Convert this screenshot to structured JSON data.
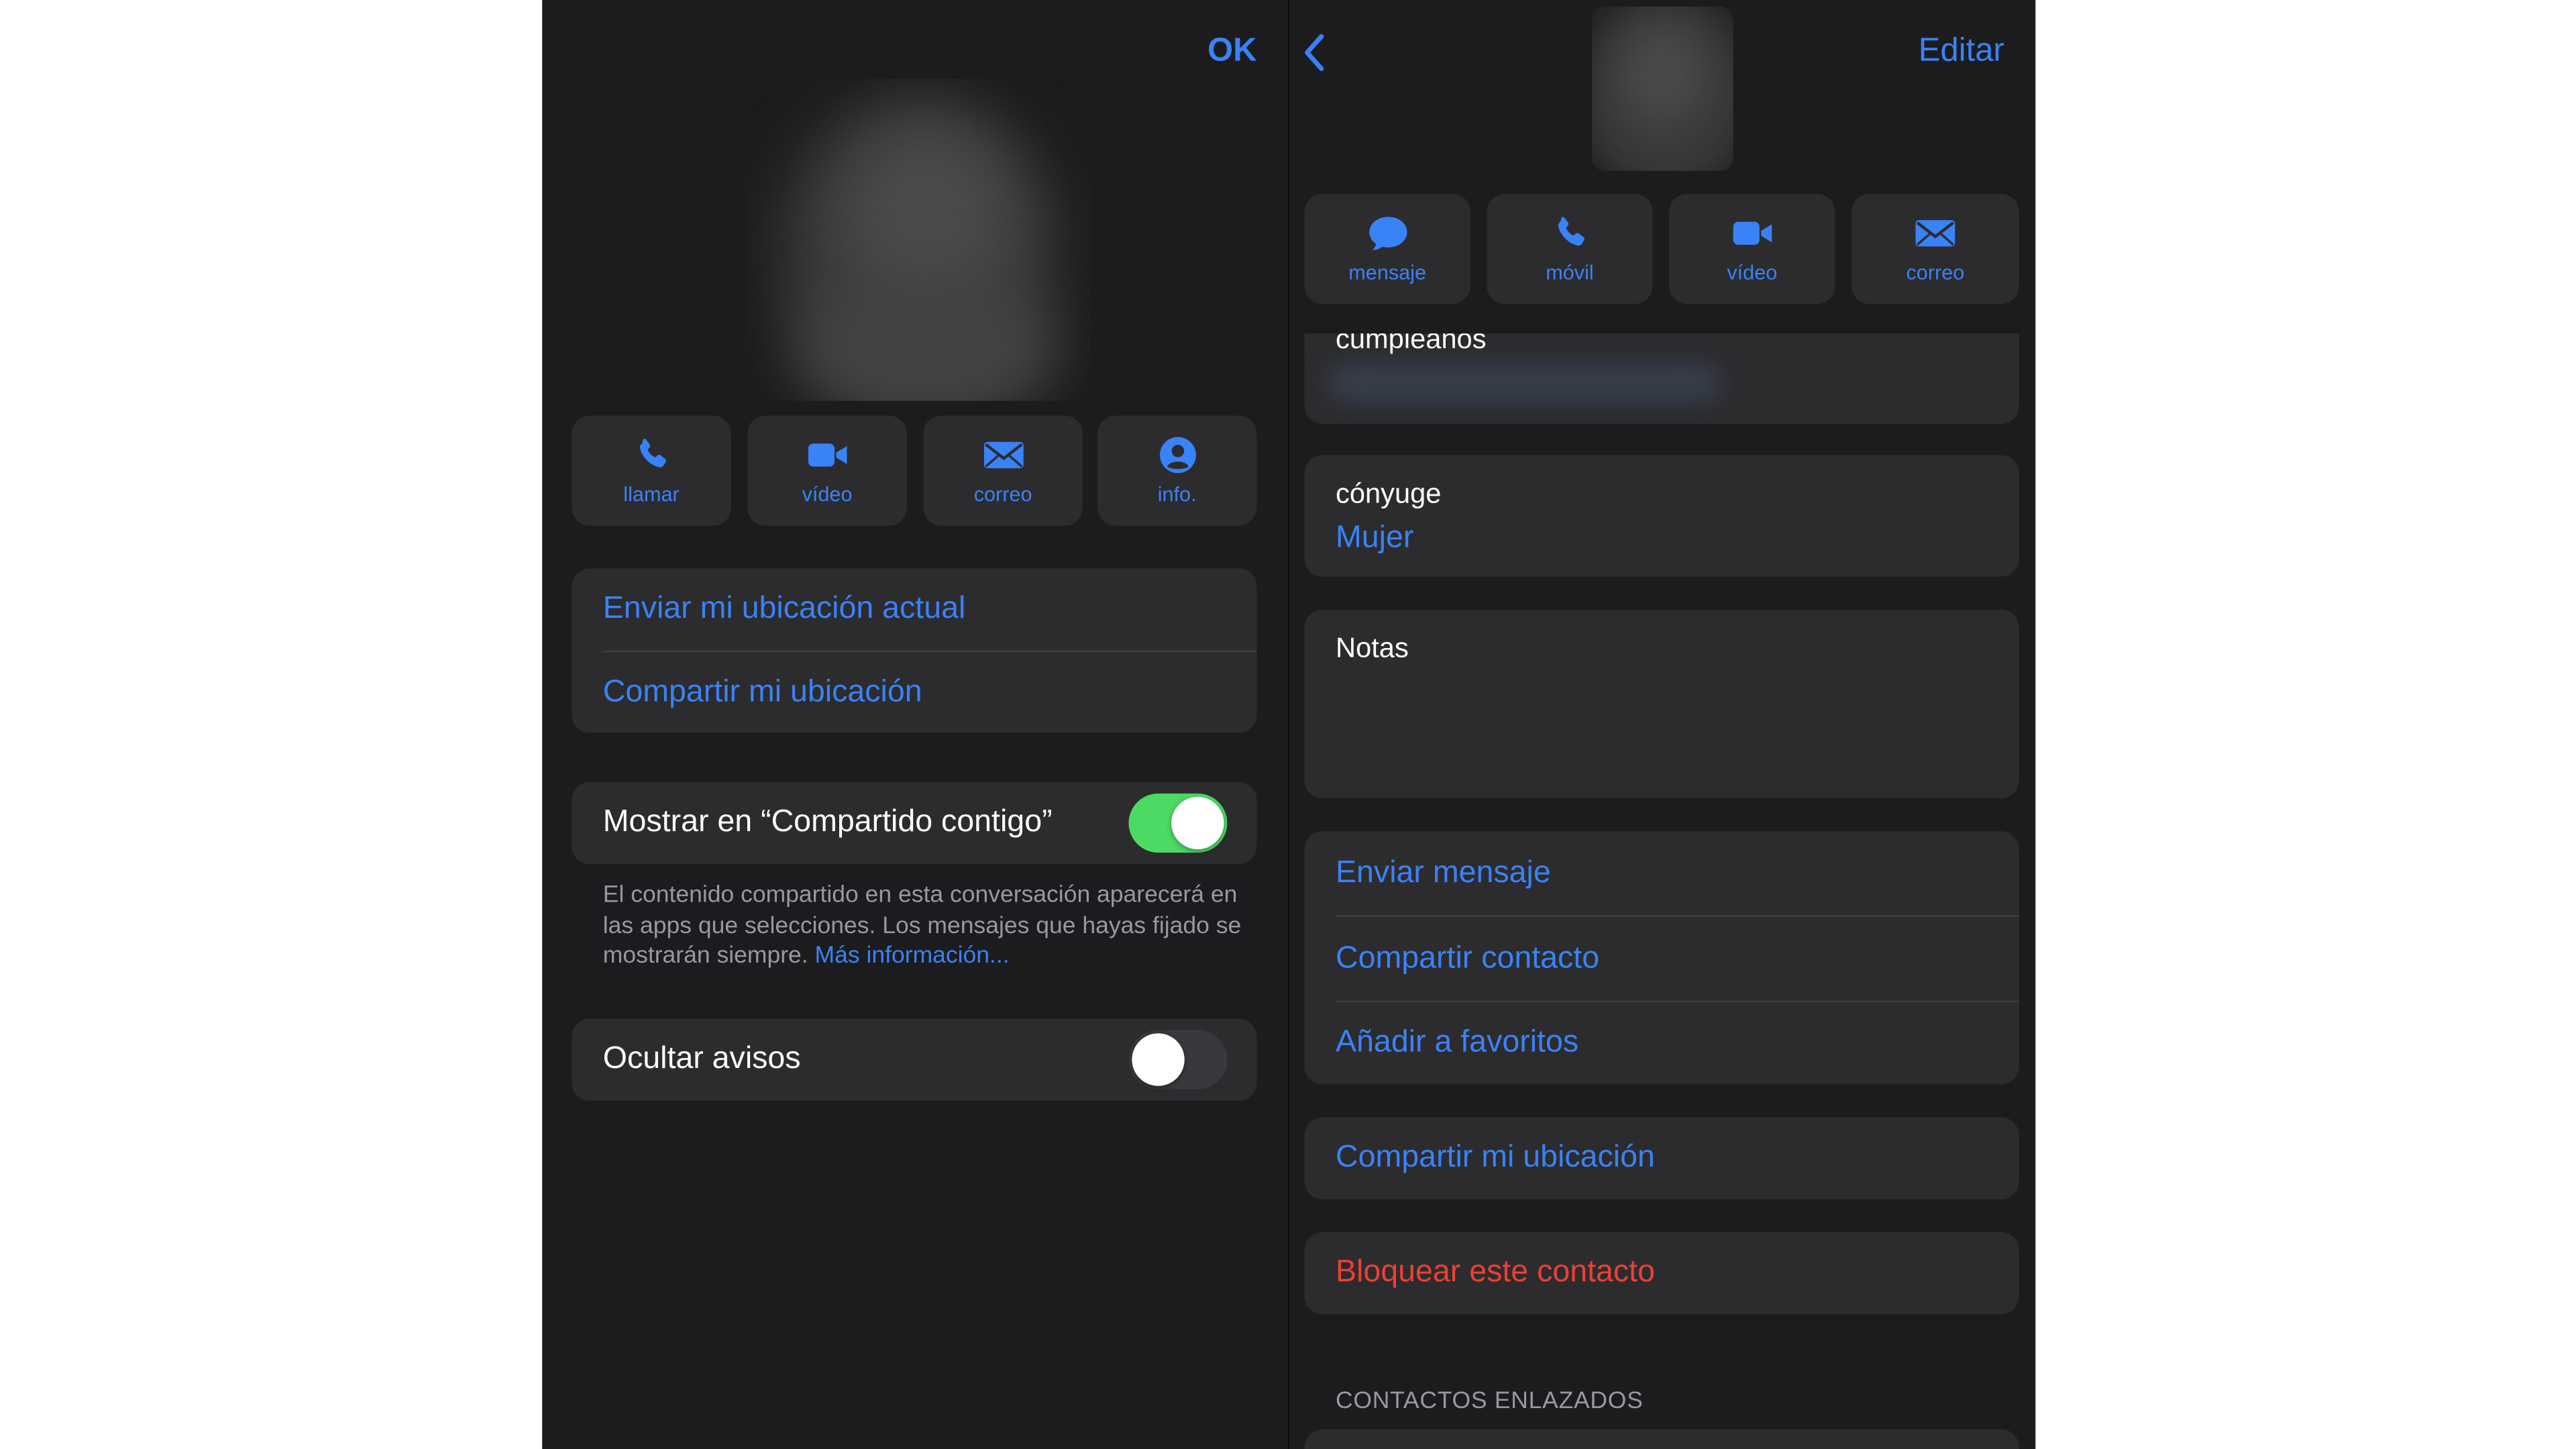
{
  "left": {
    "done_label": "OK",
    "actions": [
      {
        "label": "llamar",
        "icon": "phone-icon"
      },
      {
        "label": "vídeo",
        "icon": "video-icon"
      },
      {
        "label": "correo",
        "icon": "mail-icon"
      },
      {
        "label": "info.",
        "icon": "person-icon"
      }
    ],
    "location": {
      "send_current": "Enviar mi ubicación actual",
      "share": "Compartir mi ubicación"
    },
    "show_in_shared": {
      "label": "Mostrar en “Compartido contigo”",
      "enabled": true
    },
    "footnote": {
      "text": "El contenido compartido en esta conversación aparecerá en las apps que selecciones. Los mensajes que hayas fijado se mostrarán siempre.",
      "link": "Más información..."
    },
    "hide_alerts": {
      "label": "Ocultar avisos",
      "enabled": false
    }
  },
  "right": {
    "back_icon": "chevron-left-icon",
    "edit_label": "Editar",
    "actions": [
      {
        "label": "mensaje",
        "icon": "message-bubble-icon"
      },
      {
        "label": "móvil",
        "icon": "phone-icon"
      },
      {
        "label": "vídeo",
        "icon": "video-icon"
      },
      {
        "label": "correo",
        "icon": "mail-icon"
      }
    ],
    "birthday_label": "cumpleaños",
    "spouse": {
      "label": "cónyuge",
      "value": "Mujer"
    },
    "notes_label": "Notas",
    "contact_actions": [
      "Enviar mensaje",
      "Compartir contacto",
      "Añadir a favoritos"
    ],
    "share_location": "Compartir mi ubicación",
    "block_contact": "Bloquear este contacto",
    "linked_contacts_header": "CONTACTOS ENLAZADOS"
  },
  "colors": {
    "accent": "#3a82f7",
    "destructive": "#eb4035",
    "toggle_on": "#4cd964",
    "background": "#1c1c1e",
    "cell": "#2c2c2e"
  }
}
